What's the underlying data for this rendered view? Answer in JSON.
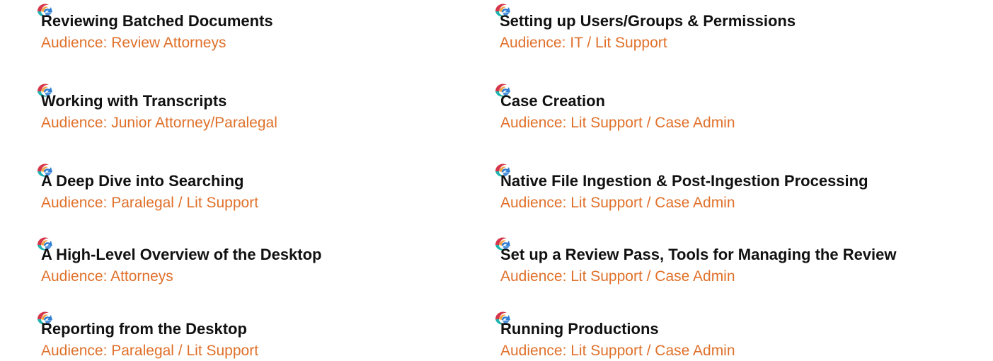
{
  "colors": {
    "title": "#111111",
    "audience": "#e0702a",
    "icon_red": "#d6364a",
    "icon_blue": "#2f7fd6",
    "icon_orange": "#f2a54a",
    "icon_teal": "#20b3b0"
  },
  "icon_name": "course-badge-icon",
  "left_column": [
    {
      "title": "Reviewing Batched Documents",
      "audience": "Audience: Review Attorneys"
    },
    {
      "title": "Working with Transcripts",
      "audience": "Audience: Junior Attorney/Paralegal"
    },
    {
      "title": "A Deep Dive into Searching",
      "audience": "Audience: Paralegal / Lit Support"
    },
    {
      "title": "A High-Level Overview of the Desktop",
      "audience": "Audience: Attorneys"
    },
    {
      "title": "Reporting from the Desktop",
      "audience": "Audience: Paralegal / Lit Support"
    }
  ],
  "right_column": [
    {
      "title": "Setting up Users/Groups & Permissions",
      "audience": "Audience: IT / Lit Support"
    },
    {
      "title": "Case Creation",
      "audience": "Audience: Lit Support / Case Admin"
    },
    {
      "title": "Native File Ingestion & Post-Ingestion Processing",
      "audience": "Audience: Lit Support / Case Admin"
    },
    {
      "title": "Set up a Review Pass, Tools for Managing the Review",
      "audience": "Audience: Lit Support / Case Admin"
    },
    {
      "title": "Running Productions",
      "audience": "Audience: Lit Support / Case Admin"
    }
  ]
}
